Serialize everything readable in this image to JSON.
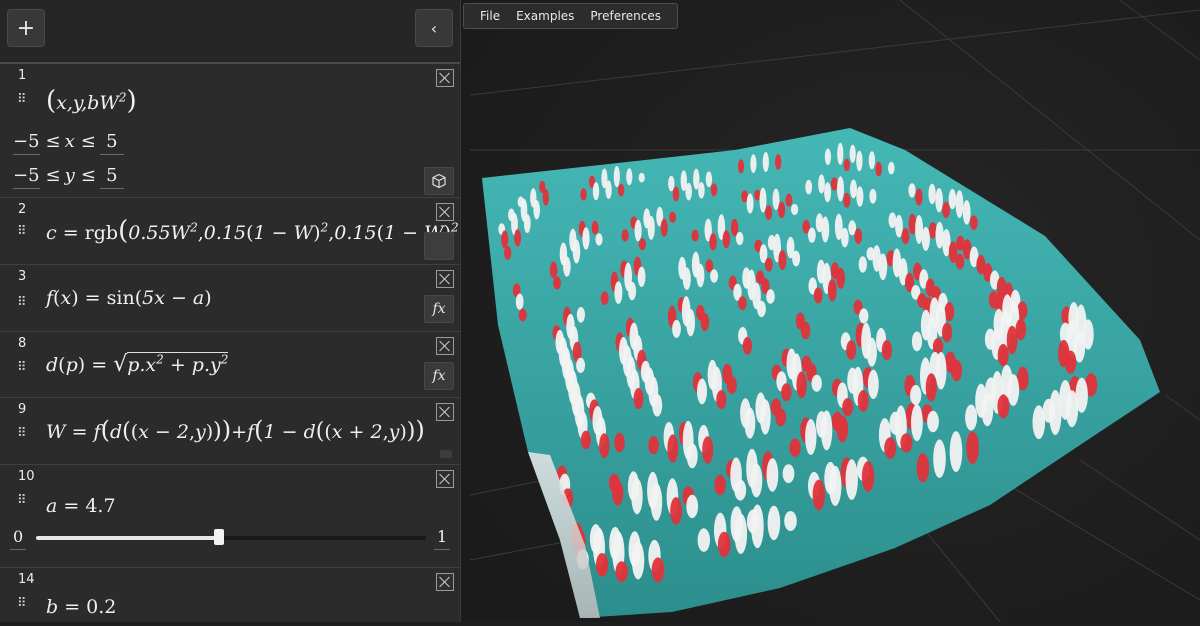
{
  "toolbar": {
    "add_label": "+",
    "collapse_label": "‹"
  },
  "menu": {
    "file": "File",
    "examples": "Examples",
    "preferences": "Preferences"
  },
  "colors": {
    "red": "#e0333a",
    "teal": "#3aaead",
    "white": "#f2f2f2"
  },
  "expressions": [
    {
      "id": "1",
      "domain_x": {
        "min": "−5",
        "max": "5",
        "var": "x"
      },
      "domain_y": {
        "min": "−5",
        "max": "5",
        "var": "y"
      }
    },
    {
      "id": "2"
    },
    {
      "id": "3"
    },
    {
      "id": "8"
    },
    {
      "id": "9"
    },
    {
      "id": "10",
      "slider": {
        "min": "0",
        "max": "1",
        "value": 0.47
      }
    },
    {
      "id": "14"
    }
  ],
  "symbols": {
    "leq": "≤",
    "fx": "fx"
  }
}
